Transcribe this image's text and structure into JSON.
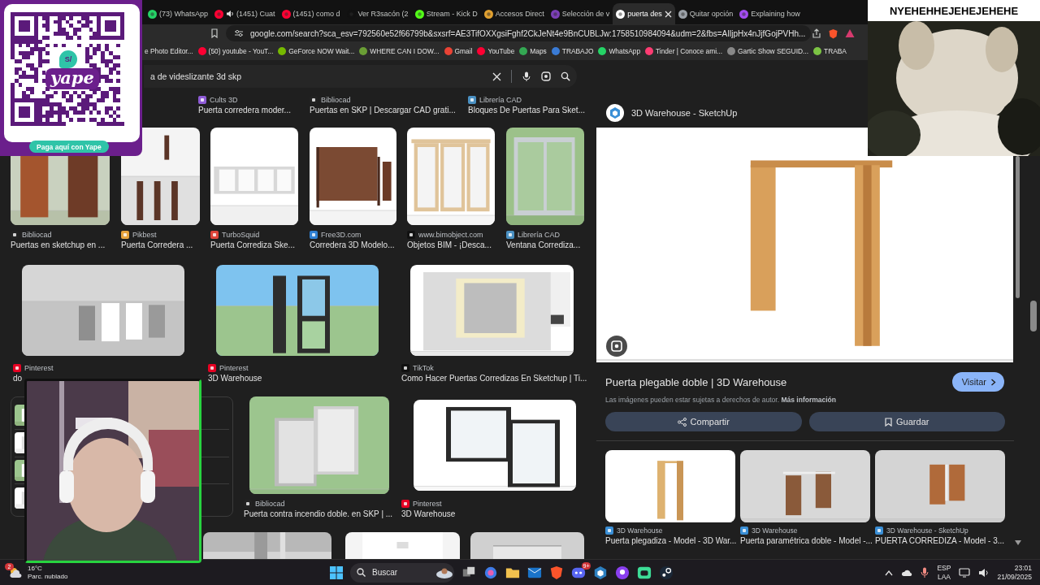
{
  "tabs": [
    {
      "title": "(73) WhatsApp",
      "audio": false,
      "selected": false
    },
    {
      "title": "(1451) Cuat",
      "audio": true,
      "selected": false
    },
    {
      "title": "(1451) como d",
      "audio": false,
      "selected": false
    },
    {
      "title": "Ver R3sacón (2",
      "audio": false,
      "selected": false
    },
    {
      "title": "Stream - Kick D",
      "audio": false,
      "selected": false
    },
    {
      "title": "Accesos Direct",
      "audio": false,
      "selected": false
    },
    {
      "title": "Selección de v",
      "audio": false,
      "selected": false
    },
    {
      "title": "puerta des",
      "audio": false,
      "selected": true
    },
    {
      "title": "Quitar opción",
      "audio": false,
      "selected": false
    },
    {
      "title": "Explaining how",
      "audio": false,
      "selected": false
    }
  ],
  "address_bar": {
    "url": "google.com/search?sca_esv=792560e52f66799b&sxsrf=AE3TifOXXgsiFghf2CkJeNt4e9BnCUBLJw:1758510984094&udm=2&fbs=AIljpHx4nJjfGojPVHh..."
  },
  "bookmarks": [
    {
      "label": "e Photo Editor..."
    },
    {
      "label": "(50) youtube - YouT..."
    },
    {
      "label": "GeForce NOW Wait..."
    },
    {
      "label": "WHERE CAN I DOW..."
    },
    {
      "label": "Gmail"
    },
    {
      "label": "YouTube"
    },
    {
      "label": "Maps"
    },
    {
      "label": "TRABAJO"
    },
    {
      "label": "WhatsApp"
    },
    {
      "label": "Tinder | Conoce ami..."
    },
    {
      "label": "Gartic Show SEGUID..."
    },
    {
      "label": "TRABA"
    }
  ],
  "search": {
    "query": "a de videslizante 3d skp"
  },
  "results": {
    "rows": [
      {
        "items": [
          {
            "kind": "result",
            "source": "Cults 3D",
            "title": "Puerta corredera moder..."
          },
          {
            "kind": "result",
            "source": "Bibliocad",
            "title": "Puertas en SKP | Descargar CAD grati..."
          },
          {
            "kind": "result",
            "source": "Librería CAD",
            "title": "Bloques De Puertas Para Sket..."
          }
        ]
      },
      {
        "items": [
          {
            "kind": "result",
            "source": "Bibliocad",
            "title": "Puertas en sketchup en ..."
          },
          {
            "kind": "result",
            "source": "Pikbest",
            "title": "Puerta Corredera ..."
          },
          {
            "kind": "result",
            "source": "TurboSquid",
            "title": "Puerta Corrediza Ske..."
          },
          {
            "kind": "result",
            "source": "Free3D.com",
            "title": "Corredera 3D Modelo..."
          },
          {
            "kind": "result",
            "source": "www.bimobject.com",
            "title": "Objetos BIM - ¡Desca..."
          },
          {
            "kind": "result",
            "source": "Librería CAD",
            "title": "Ventana Corrediza..."
          }
        ]
      },
      {
        "items": [
          {
            "kind": "result",
            "source": "Pinterest",
            "title": "do"
          },
          {
            "kind": "result",
            "source": "Pinterest",
            "title": "3D Warehouse"
          },
          {
            "kind": "result",
            "source": "TikTok",
            "title": "Como Hacer Puertas Corredizas En Sketchup | Ti..."
          }
        ]
      },
      {
        "items": [
          {
            "kind": "list_card"
          },
          {
            "kind": "result",
            "source": "Bibliocad",
            "title": "Puerta contra incendio doble. en SKP | ..."
          },
          {
            "kind": "result",
            "source": "Pinterest",
            "title": "3D Warehouse"
          }
        ]
      },
      {
        "items": [
          {
            "kind": "picture"
          },
          {
            "kind": "picture"
          },
          {
            "kind": "picture"
          }
        ]
      }
    ]
  },
  "viewer": {
    "site": "3D Warehouse - SketchUp",
    "title": "Puerta plegable doble | 3D Warehouse",
    "visit_button": "Visitar",
    "notice": "Las imágenes pueden estar sujetas a derechos de autor.",
    "notice_link": "Más información",
    "actions": [
      "Compartir",
      "Guardar"
    ],
    "related": [
      {
        "source": "3D Warehouse",
        "title": "Puerta plegadiza - Model - 3D War..."
      },
      {
        "source": "3D Warehouse",
        "title": "Puerta paramétrica doble - Model -..."
      },
      {
        "source": "3D Warehouse - SketchUp",
        "title": "PUERTA CORREDIZA - Model - 3..."
      }
    ]
  },
  "overlays": {
    "qr_card": {
      "currency": "S/",
      "logo": "yape",
      "button": "Paga aquí con Yape"
    },
    "meme_video": {
      "caption": "NYEHEHHEJEHEJEHEHE"
    }
  },
  "taskbar": {
    "weather": {
      "temperature": "16°C",
      "condition": "Parc. nublado",
      "badge": "2"
    },
    "search": {
      "placeholder": "Buscar"
    },
    "app_badge": "9+",
    "language": "ESP",
    "layout": "LAA",
    "time": "23:01",
    "date": "21/09/2025"
  }
}
